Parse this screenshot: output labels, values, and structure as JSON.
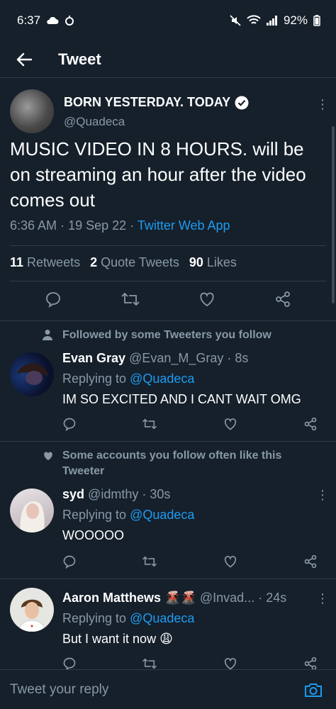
{
  "status_bar": {
    "time": "6:37",
    "battery": "92%"
  },
  "header": {
    "title": "Tweet"
  },
  "main_tweet": {
    "name": "BORN YESTERDAY. TODAY",
    "handle": "@Quadeca",
    "text": "MUSIC VIDEO IN 8 HOURS. will be on streaming an hour after the video comes out",
    "time": "6:36 AM",
    "date": "19 Sep 22",
    "source": "Twitter Web App",
    "retweets_count": "11",
    "retweets_label": "Retweets",
    "quotes_count": "2",
    "quotes_label": "Quote Tweets",
    "likes_count": "90",
    "likes_label": "Likes"
  },
  "replies": [
    {
      "context": "Followed by some Tweeters you follow",
      "context_icon": "person-icon",
      "name": "Evan Gray",
      "handle": "@Evan_M_Gray",
      "time": "8s",
      "replying_prefix": "Replying to",
      "replying_to": "@Quadeca",
      "text": "IM SO EXCITED AND I CANT WAIT OMG"
    },
    {
      "context": "Some accounts you follow often like this Tweeter",
      "context_icon": "heart-icon",
      "name": "syd",
      "handle": "@idmthy",
      "time": "30s",
      "replying_prefix": "Replying to",
      "replying_to": "@Quadeca",
      "text": "WOOOOO"
    },
    {
      "context": "",
      "name": "Aaron Matthews",
      "name_emoji": "🌋🌋",
      "handle": "@Invad...",
      "time": "24s",
      "replying_prefix": "Replying to",
      "replying_to": "@Quadeca",
      "text": "But I want it now",
      "text_emoji": "😩"
    }
  ],
  "compose": {
    "placeholder": "Tweet your reply"
  },
  "colors": {
    "background": "#15202b",
    "accent": "#1d9bf0",
    "secondary_text": "#8899a6",
    "divider": "#2f3b47"
  }
}
